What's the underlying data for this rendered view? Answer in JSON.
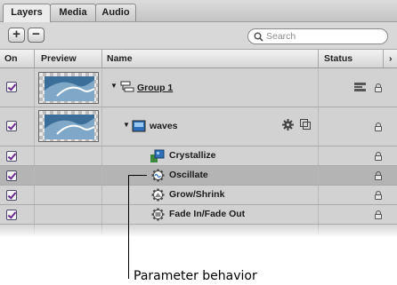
{
  "tabs": [
    {
      "label": "Layers",
      "active": true
    },
    {
      "label": "Media",
      "active": false
    },
    {
      "label": "Audio",
      "active": false
    }
  ],
  "toolbar": {
    "add_label": "+",
    "remove_label": "−",
    "search_placeholder": "Search"
  },
  "columns": {
    "on": "On",
    "preview": "Preview",
    "name": "Name",
    "status": "Status",
    "more": "›"
  },
  "rows": [
    {
      "name": "Group 1",
      "type": "group",
      "checked": true,
      "expanded": true
    },
    {
      "name": "waves",
      "type": "layer",
      "checked": true,
      "expanded": true
    },
    {
      "name": "Crystallize",
      "type": "filter",
      "checked": true
    },
    {
      "name": "Oscillate",
      "type": "parameter-behavior",
      "checked": true,
      "selected": true
    },
    {
      "name": "Grow/Shrink",
      "type": "behavior",
      "checked": true
    },
    {
      "name": "Fade In/Fade Out",
      "type": "behavior",
      "checked": true
    }
  ],
  "callout": "Parameter behavior",
  "colors": {
    "selected_row": "#b4b4b4",
    "row_bg": "#d2d2d2",
    "checkmark": "#6a2a8e"
  }
}
